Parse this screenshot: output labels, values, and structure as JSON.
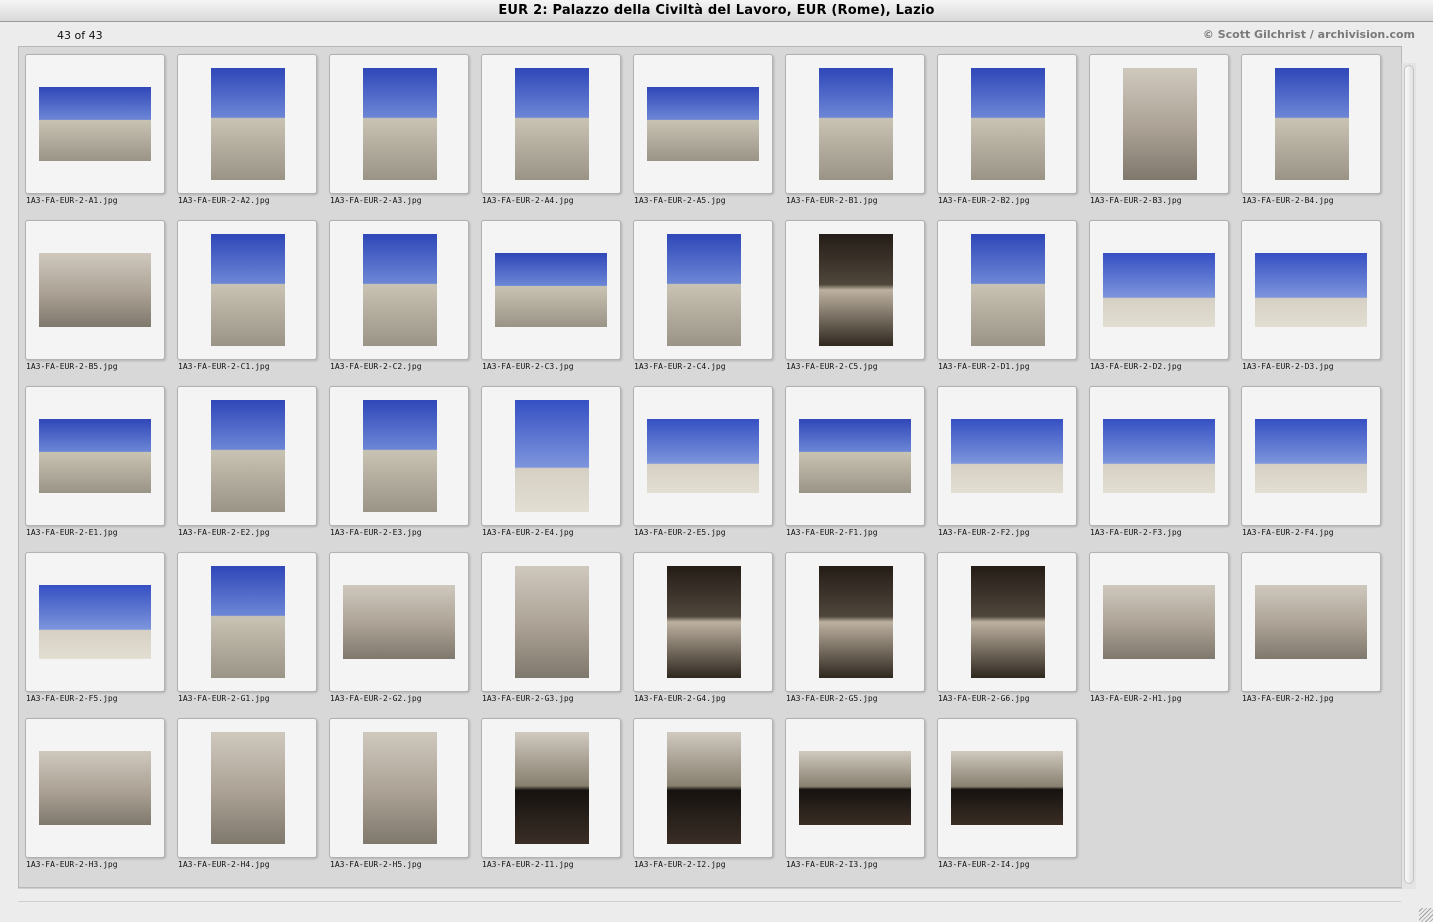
{
  "window": {
    "title": "EUR 2: Palazzo della Civiltà del Lavoro, EUR (Rome), Lazio"
  },
  "toolbar": {
    "counter": "43 of 43",
    "credit": "© Scott Gilchrist / archivision.com"
  },
  "thumbnails": [
    {
      "file": "1A3-FA-EUR-2-A1.jpg",
      "orientation": "landscape",
      "tone": "sky"
    },
    {
      "file": "1A3-FA-EUR-2-A2.jpg",
      "orientation": "portrait",
      "tone": "sky"
    },
    {
      "file": "1A3-FA-EUR-2-A3.jpg",
      "orientation": "portrait",
      "tone": "sky"
    },
    {
      "file": "1A3-FA-EUR-2-A4.jpg",
      "orientation": "portrait",
      "tone": "sky"
    },
    {
      "file": "1A3-FA-EUR-2-A5.jpg",
      "orientation": "landscape",
      "tone": "sky"
    },
    {
      "file": "1A3-FA-EUR-2-B1.jpg",
      "orientation": "portrait",
      "tone": "sky"
    },
    {
      "file": "1A3-FA-EUR-2-B2.jpg",
      "orientation": "portrait",
      "tone": "sky"
    },
    {
      "file": "1A3-FA-EUR-2-B3.jpg",
      "orientation": "portrait",
      "tone": "stone"
    },
    {
      "file": "1A3-FA-EUR-2-B4.jpg",
      "orientation": "portrait",
      "tone": "sky"
    },
    {
      "file": "1A3-FA-EUR-2-B5.jpg",
      "orientation": "landscape",
      "tone": "stone"
    },
    {
      "file": "1A3-FA-EUR-2-C1.jpg",
      "orientation": "portrait",
      "tone": "sky"
    },
    {
      "file": "1A3-FA-EUR-2-C2.jpg",
      "orientation": "portrait",
      "tone": "sky"
    },
    {
      "file": "1A3-FA-EUR-2-C3.jpg",
      "orientation": "landscape",
      "tone": "sky"
    },
    {
      "file": "1A3-FA-EUR-2-C4.jpg",
      "orientation": "portrait",
      "tone": "sky"
    },
    {
      "file": "1A3-FA-EUR-2-C5.jpg",
      "orientation": "portrait",
      "tone": "dark"
    },
    {
      "file": "1A3-FA-EUR-2-D1.jpg",
      "orientation": "portrait",
      "tone": "sky"
    },
    {
      "file": "1A3-FA-EUR-2-D2.jpg",
      "orientation": "landscape",
      "tone": "statue"
    },
    {
      "file": "1A3-FA-EUR-2-D3.jpg",
      "orientation": "landscape",
      "tone": "statue"
    },
    {
      "file": "1A3-FA-EUR-2-E1.jpg",
      "orientation": "landscape",
      "tone": "sky"
    },
    {
      "file": "1A3-FA-EUR-2-E2.jpg",
      "orientation": "portrait",
      "tone": "sky"
    },
    {
      "file": "1A3-FA-EUR-2-E3.jpg",
      "orientation": "portrait",
      "tone": "sky"
    },
    {
      "file": "1A3-FA-EUR-2-E4.jpg",
      "orientation": "portrait",
      "tone": "statue"
    },
    {
      "file": "1A3-FA-EUR-2-E5.jpg",
      "orientation": "landscape",
      "tone": "statue"
    },
    {
      "file": "1A3-FA-EUR-2-F1.jpg",
      "orientation": "landscape",
      "tone": "sky"
    },
    {
      "file": "1A3-FA-EUR-2-F2.jpg",
      "orientation": "landscape",
      "tone": "statue"
    },
    {
      "file": "1A3-FA-EUR-2-F3.jpg",
      "orientation": "landscape",
      "tone": "statue"
    },
    {
      "file": "1A3-FA-EUR-2-F4.jpg",
      "orientation": "landscape",
      "tone": "statue"
    },
    {
      "file": "1A3-FA-EUR-2-F5.jpg",
      "orientation": "landscape",
      "tone": "statue"
    },
    {
      "file": "1A3-FA-EUR-2-G1.jpg",
      "orientation": "portrait",
      "tone": "sky"
    },
    {
      "file": "1A3-FA-EUR-2-G2.jpg",
      "orientation": "landscape",
      "tone": "stone"
    },
    {
      "file": "1A3-FA-EUR-2-G3.jpg",
      "orientation": "portrait",
      "tone": "stone"
    },
    {
      "file": "1A3-FA-EUR-2-G4.jpg",
      "orientation": "portrait",
      "tone": "dark"
    },
    {
      "file": "1A3-FA-EUR-2-G5.jpg",
      "orientation": "portrait",
      "tone": "dark"
    },
    {
      "file": "1A3-FA-EUR-2-G6.jpg",
      "orientation": "portrait",
      "tone": "dark"
    },
    {
      "file": "1A3-FA-EUR-2-H1.jpg",
      "orientation": "landscape",
      "tone": "stone"
    },
    {
      "file": "1A3-FA-EUR-2-H2.jpg",
      "orientation": "landscape",
      "tone": "stone"
    },
    {
      "file": "1A3-FA-EUR-2-H3.jpg",
      "orientation": "landscape",
      "tone": "stone"
    },
    {
      "file": "1A3-FA-EUR-2-H4.jpg",
      "orientation": "portrait",
      "tone": "stone"
    },
    {
      "file": "1A3-FA-EUR-2-H5.jpg",
      "orientation": "portrait",
      "tone": "stone"
    },
    {
      "file": "1A3-FA-EUR-2-I1.jpg",
      "orientation": "portrait",
      "tone": "interior"
    },
    {
      "file": "1A3-FA-EUR-2-I2.jpg",
      "orientation": "portrait",
      "tone": "interior"
    },
    {
      "file": "1A3-FA-EUR-2-I3.jpg",
      "orientation": "landscape",
      "tone": "interior"
    },
    {
      "file": "1A3-FA-EUR-2-I4.jpg",
      "orientation": "landscape",
      "tone": "interior"
    }
  ]
}
